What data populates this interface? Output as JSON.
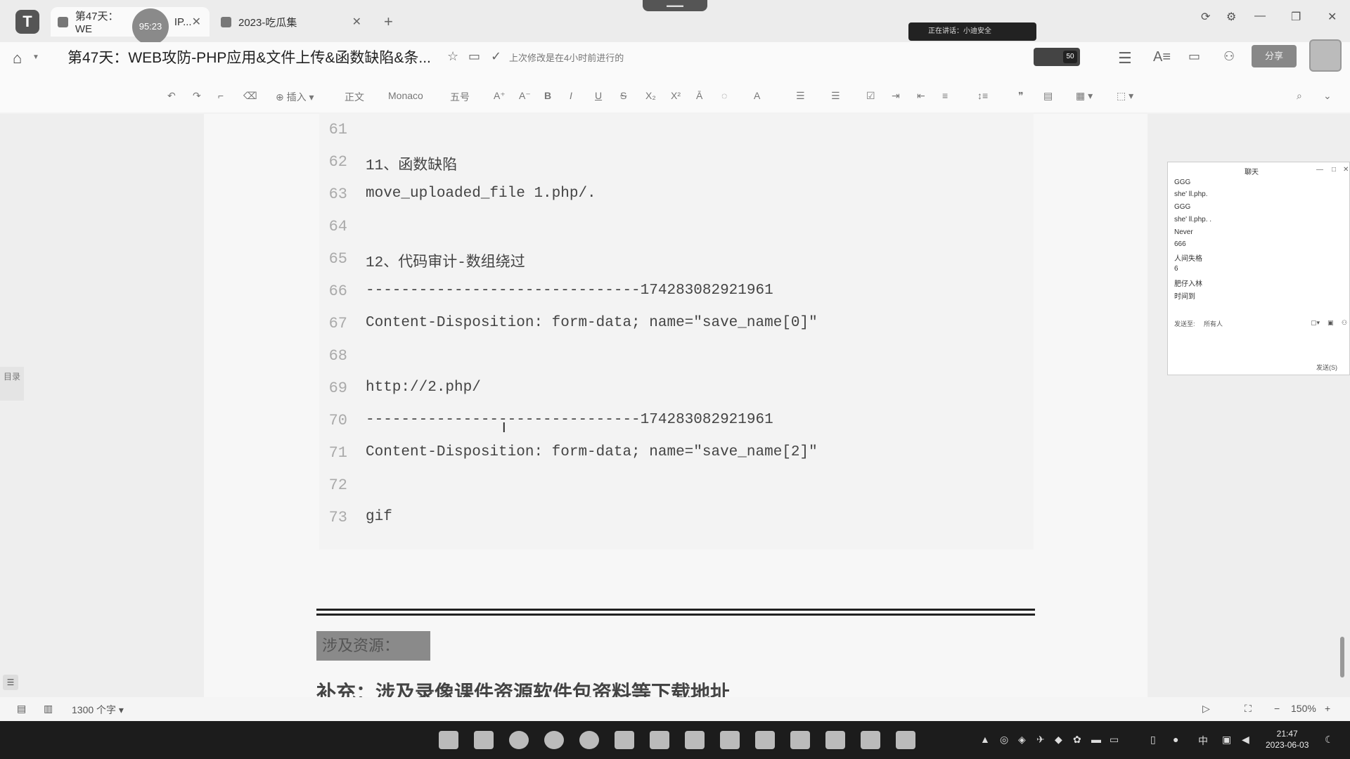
{
  "browser": {
    "tabs": [
      {
        "title": "第47天：WE",
        "suffix": "IP...",
        "close": "✕"
      },
      {
        "title": "2023-吃瓜集",
        "close": "✕"
      }
    ],
    "recording_timer": "95:23",
    "new_tab": "+"
  },
  "header": {
    "doc_title": "第47天：WEB攻防-PHP应用&文件上传&函数缺陷&条...",
    "saved_status": "上次修改是在4小时前进行的",
    "notification": "正在讲话：小迪安全",
    "collab_count": "50",
    "share_label": "分享"
  },
  "toolbar": {
    "insert": "插入",
    "style": "正文",
    "font": "Monaco",
    "size": "五号"
  },
  "sidebar": {
    "toc_label": "目录"
  },
  "code_lines": [
    {
      "num": "61",
      "text": ""
    },
    {
      "num": "62",
      "text": "11、函数缺陷"
    },
    {
      "num": "63",
      "text": "move_uploaded_file 1.php/."
    },
    {
      "num": "64",
      "text": ""
    },
    {
      "num": "65",
      "text": "12、代码审计-数组绕过"
    },
    {
      "num": "66",
      "text": "-------------------------------174283082921961"
    },
    {
      "num": "67",
      "text": "Content-Disposition: form-data; name=\"save_name[0]\""
    },
    {
      "num": "68",
      "text": ""
    },
    {
      "num": "69",
      "text": "http://2.php/"
    },
    {
      "num": "70",
      "text": "-------------------------------174283082921961"
    },
    {
      "num": "71",
      "text": "Content-Disposition: form-data; name=\"save_name[2]\""
    },
    {
      "num": "72",
      "text": ""
    },
    {
      "num": "73",
      "text": "gif"
    }
  ],
  "section": {
    "heading": "涉及资源：",
    "note": "补充：涉及录像课件资源软件包资料等下载地址"
  },
  "chat": {
    "title": "聊天",
    "messages": [
      "GGG",
      "she' ll.php.",
      "GGG",
      "she' ll.php. .",
      "Never",
      "666",
      "人间失格",
      "6",
      "肥仔入林",
      "时间到"
    ],
    "send_to_label": "发送至:",
    "send_to_value": "所有人",
    "send_button": "发送(S)"
  },
  "statusbar": {
    "word_count": "1300 个字",
    "zoom": "150%"
  },
  "taskbar": {
    "ime": "中",
    "time": "21:47",
    "date": "2023-06-03"
  }
}
